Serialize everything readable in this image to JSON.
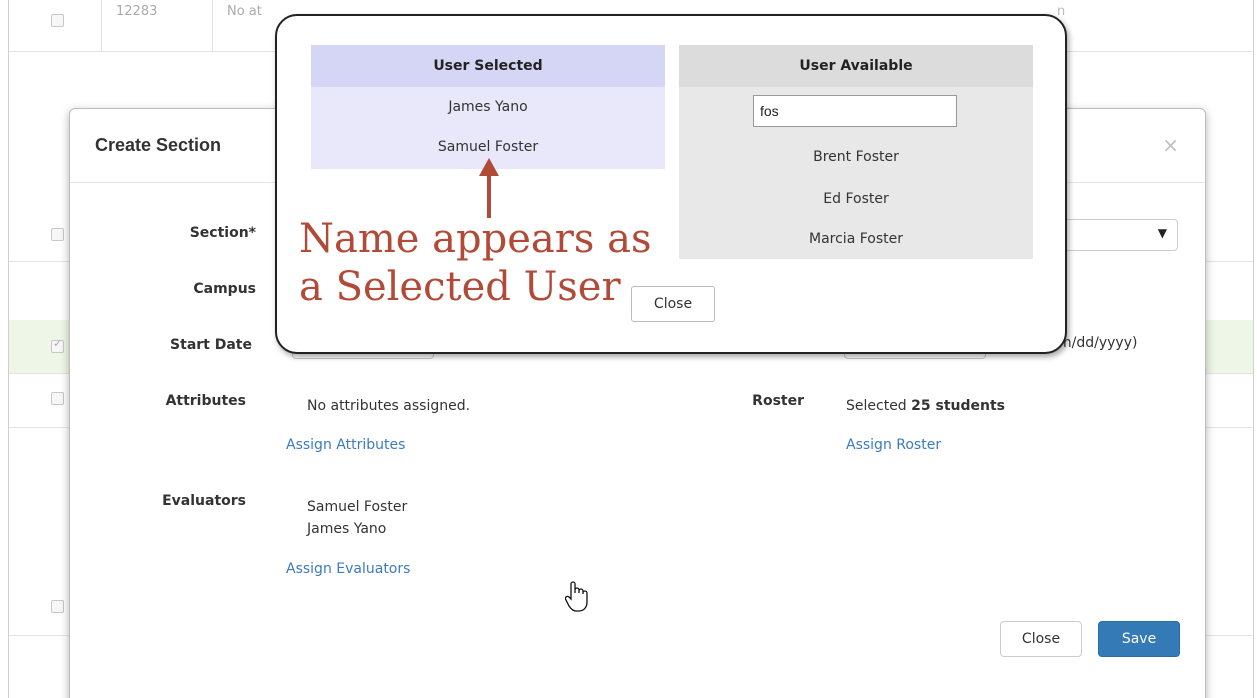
{
  "background": {
    "row_id": "12283",
    "row_text": "No at",
    "row_text_right": "n"
  },
  "create_section": {
    "title": "Create Section",
    "close_x": "×",
    "labels": {
      "section": "Section*",
      "campus": "Campus",
      "start_date": "Start Date",
      "attributes": "Attributes",
      "evaluators": "Evaluators",
      "roster": "Roster"
    },
    "date_hint": "m/dd/yyyy)",
    "attributes_value": "No attributes assigned.",
    "assign_attributes": "Assign Attributes",
    "roster_prefix": "Selected",
    "roster_count": "25 students",
    "assign_roster": "Assign Roster",
    "evaluators": [
      "Samuel Foster",
      "James Yano"
    ],
    "assign_evaluators": "Assign Evaluators",
    "close_button": "Close",
    "save_button": "Save"
  },
  "user_picker": {
    "selected_header": "User Selected",
    "selected_users": [
      "James Yano",
      "Samuel Foster"
    ],
    "available_header": "User Available",
    "search_value": "fos",
    "available_users": [
      "Brent Foster",
      "Ed Foster",
      "Marcia Foster"
    ],
    "close_button": "Close"
  },
  "annotation": {
    "line1": "Name appears as",
    "line2": "a Selected User",
    "color": "#b24a38"
  },
  "colors": {
    "link": "#3b7bbf",
    "primary": "#337ab7",
    "selected_panel": "#e8e8fa",
    "selected_header": "#d5d5f5",
    "available_panel": "#e8e8e8"
  }
}
